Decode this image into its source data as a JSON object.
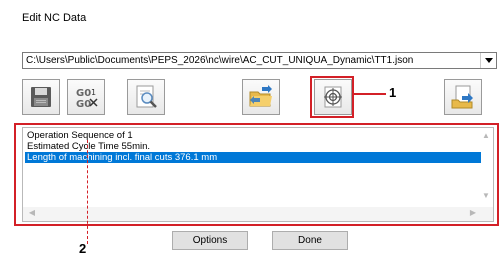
{
  "window": {
    "title": "Edit NC Data"
  },
  "file_select": {
    "value": "C:\\Users\\Public\\Documents\\PEPS_2026\\nc\\wire\\AC_CUT_UNIQUA_Dynamic\\TT1.json"
  },
  "toolbar": {
    "buttons": [
      {
        "icon": "save-icon"
      },
      {
        "icon": "goto-line-icon"
      },
      {
        "icon": "search-document-icon"
      },
      {
        "icon": "folder-transfer-icon"
      },
      {
        "icon": "target-crosshair-icon"
      },
      {
        "icon": "export-document-icon"
      }
    ]
  },
  "callouts": {
    "one": "1",
    "two": "2"
  },
  "output_list": {
    "items": [
      "Operation Sequence of 1",
      "Estimated Cycle Time 55min.",
      "Length of machining incl. final cuts 376.1 mm"
    ],
    "selected_index": 2
  },
  "buttons": {
    "options": "Options",
    "done": "Done"
  },
  "colors": {
    "highlight": "#d32027",
    "selection": "#0078d7"
  }
}
